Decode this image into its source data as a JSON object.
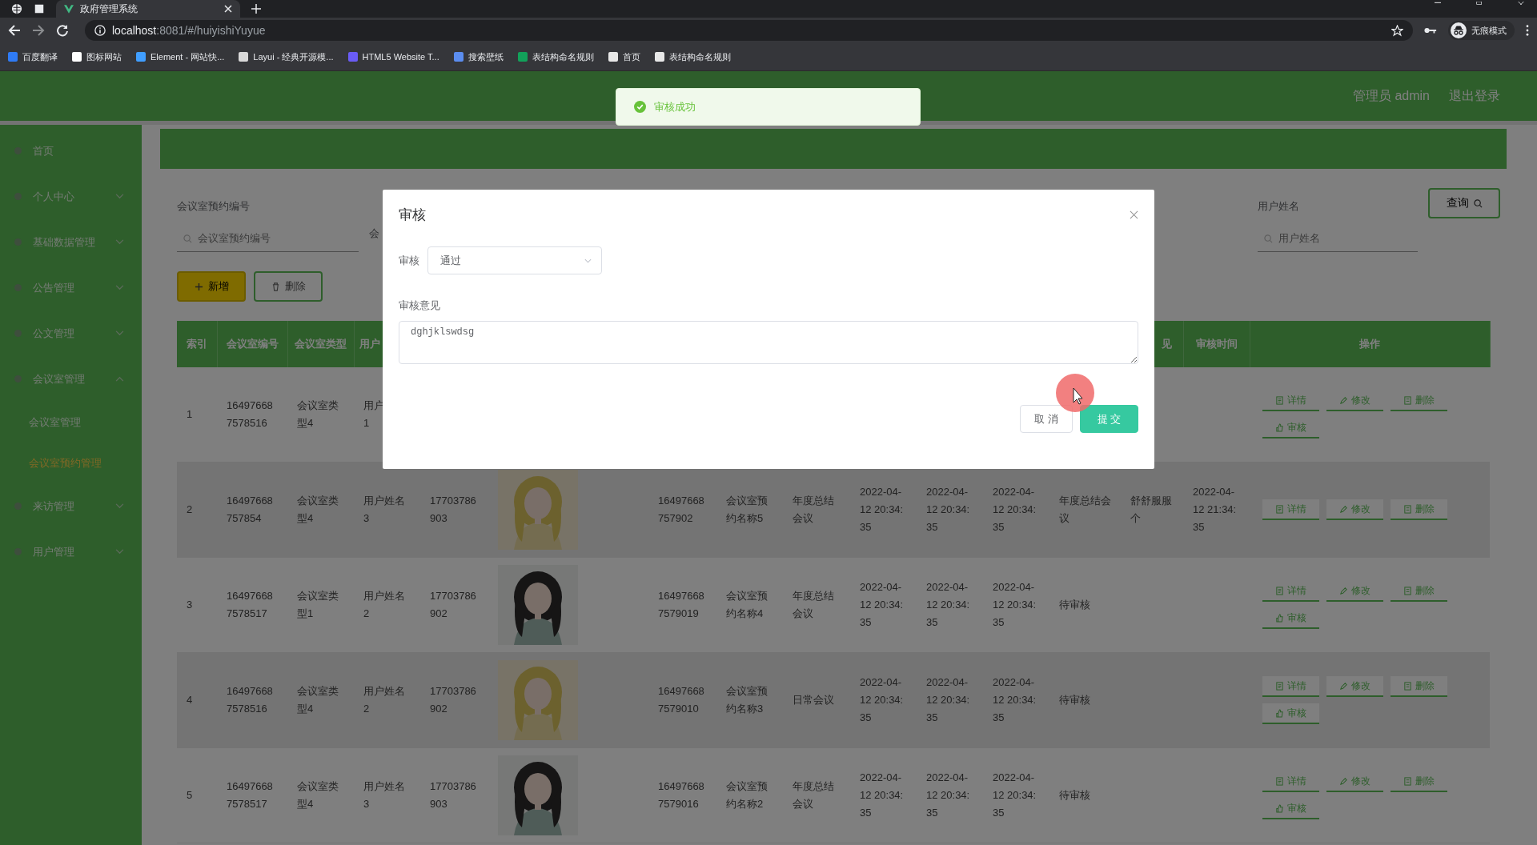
{
  "browser": {
    "tab_title": "政府管理系统",
    "url_host": "localhost",
    "url_rest": ":8081/#/huiyishiYuyue",
    "profile": "无痕模式",
    "bookmarks": [
      {
        "label": "百度翻译",
        "color": "#2f7bf5"
      },
      {
        "label": "图标网站",
        "color": "#ffffff"
      },
      {
        "label": "Element - 网站快...",
        "color": "#409eff"
      },
      {
        "label": "Layui - 经典开源模...",
        "color": "#d9d9d9"
      },
      {
        "label": "HTML5 Website T...",
        "color": "#6a5cf5"
      },
      {
        "label": "搜索壁纸",
        "color": "#5b8def"
      },
      {
        "label": "表结构命名规则",
        "color": "#12a15a"
      },
      {
        "label": "首页",
        "color": "#e8e8e8"
      },
      {
        "label": "表结构命名规则",
        "color": "#e8e8e8"
      }
    ]
  },
  "header": {
    "user": "管理员 admin",
    "logout": "退出登录"
  },
  "toast": {
    "text": "审核成功"
  },
  "sidebar": {
    "items": [
      {
        "kind": "link",
        "label": "首页"
      },
      {
        "kind": "menu",
        "label": "个人中心",
        "expanded": false
      },
      {
        "kind": "menu",
        "label": "基础数据管理",
        "expanded": false
      },
      {
        "kind": "menu",
        "label": "公告管理",
        "expanded": false
      },
      {
        "kind": "menu",
        "label": "公文管理",
        "expanded": false
      },
      {
        "kind": "menu",
        "label": "会议室管理",
        "expanded": true,
        "children": [
          {
            "label": "会议室管理",
            "selected": false
          },
          {
            "label": "会议室预约管理",
            "selected": true
          }
        ]
      },
      {
        "kind": "menu",
        "label": "来访管理",
        "expanded": false
      },
      {
        "kind": "menu",
        "label": "用户管理",
        "expanded": false
      }
    ]
  },
  "search": {
    "fields": [
      {
        "label": "会议室预约编号",
        "placeholder": "会议室预约编号"
      },
      {
        "label": "会"
      },
      {
        "label": "用户姓名",
        "placeholder": "用户姓名"
      }
    ],
    "query_button": "查询"
  },
  "toolbar": {
    "buttons": [
      {
        "kind": "add",
        "label": "新增"
      },
      {
        "kind": "delete",
        "label": "删除"
      }
    ]
  },
  "table": {
    "columns": [
      {
        "label": "索引"
      },
      {
        "label": "会议室编号"
      },
      {
        "label": "会议室类型"
      },
      {
        "label": "用户"
      },
      {},
      {},
      {},
      {},
      {},
      {},
      {},
      {},
      {},
      {
        "label": "见"
      },
      {
        "label": "审核时间"
      },
      {
        "label": "操作"
      }
    ],
    "rows": [
      {
        "cells": [
          "1",
          "164976687578516",
          "会议室类型4",
          "用户\n1"
        ],
        "actions": [
          {
            "kind": "detail",
            "label": "详情"
          },
          {
            "kind": "edit",
            "label": "修改"
          },
          {
            "kind": "delete",
            "label": "删除"
          },
          {
            "kind": "review",
            "label": "审核"
          }
        ]
      },
      {
        "cells": [
          "2",
          "16497668757854",
          "会议室类型4",
          "用户姓名3",
          "17703786903",
          {
            "kind": "picture"
          },
          "16497668757902",
          "会议室预约名称5",
          "年度总结会议",
          "2022-04-12 20:34:35",
          "2022-04-12 20:34:35",
          "2022-04-12 20:34:35",
          "年度总结会议",
          "舒舒服服个",
          "2022-04-12 21:34:35"
        ],
        "actions": [
          {
            "kind": "detail",
            "label": "详情"
          },
          {
            "kind": "edit",
            "label": "修改"
          },
          {
            "kind": "delete",
            "label": "删除"
          }
        ]
      },
      {
        "cells": [
          "3",
          "164976687578517",
          "会议室类型1",
          "用户姓名2",
          "17703786902",
          {
            "kind": "picture"
          },
          "164976687579019",
          "会议室预约名称4",
          "年度总结会议",
          "2022-04-12 20:34:35",
          "2022-04-12 20:34:35",
          "2022-04-12 20:34:35",
          "待审核"
        ],
        "actions": [
          {
            "kind": "detail",
            "label": "详情"
          },
          {
            "kind": "edit",
            "label": "修改"
          },
          {
            "kind": "delete",
            "label": "删除"
          },
          {
            "kind": "review",
            "label": "审核"
          }
        ]
      },
      {
        "cells": [
          "4",
          "164976687578516",
          "会议室类型4",
          "用户姓名2",
          "17703786902",
          {
            "kind": "picture"
          },
          "164976687579010",
          "会议室预约名称3",
          "日常会议",
          "2022-04-12 20:34:35",
          "2022-04-12 20:34:35",
          "2022-04-12 20:34:35",
          "待审核"
        ],
        "actions": [
          {
            "kind": "detail",
            "label": "详情"
          },
          {
            "kind": "edit",
            "label": "修改"
          },
          {
            "kind": "delete",
            "label": "删除"
          },
          {
            "kind": "review",
            "label": "审核"
          }
        ]
      },
      {
        "cells": [
          "5",
          "164976687578517",
          "会议室类型4",
          "用户姓名3",
          "17703786903",
          {
            "kind": "picture"
          },
          "164976687579016",
          "会议室预约名称2",
          "年度总结会议",
          "2022-04-12 20:34:35",
          "2022-04-12 20:34:35",
          "2022-04-12 20:34:35",
          "待审核"
        ],
        "actions": [
          {
            "kind": "detail",
            "label": "详情"
          },
          {
            "kind": "edit",
            "label": "修改"
          },
          {
            "kind": "delete",
            "label": "删除"
          },
          {
            "kind": "review",
            "label": "审核"
          }
        ]
      }
    ]
  },
  "dialog": {
    "title": "审核",
    "fields": [
      {
        "kind": "select",
        "label": "审核",
        "value": "通过"
      },
      {
        "kind": "textarea",
        "label": "审核意见",
        "value": "dghjklswdsg"
      }
    ],
    "buttons": [
      {
        "kind": "cancel",
        "label": "取 消"
      },
      {
        "kind": "submit",
        "label": "提 交"
      }
    ]
  }
}
